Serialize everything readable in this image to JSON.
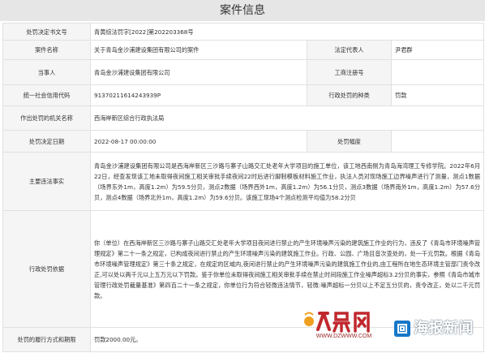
{
  "page": {
    "title": "案件信息"
  },
  "rows": {
    "decision_no": {
      "label": "处罚决定书文号",
      "value": "青黄综法罚字[2022]第202203368号"
    },
    "case_name": {
      "label": "案件名称",
      "value": "关于青岛金沙浦建设集团有限公司的案件"
    },
    "legal_rep": {
      "label": "法定代表人",
      "value": "尹君群"
    },
    "party": {
      "label": "当事人",
      "value": "青岛金沙浦建设集团有限公司"
    },
    "reg_no": {
      "label": "工商注册号",
      "value": ""
    },
    "credit_code": {
      "label": "统一社会信用代码",
      "value": "91370211614243939P"
    },
    "penalty_type": {
      "label": "行政处罚的种类",
      "value": "罚款"
    },
    "authority": {
      "label": "作出处罚的机关名称",
      "value": "西海岸新区综合行政执法局"
    },
    "decision_date": {
      "label": "处罚决定日期",
      "value": "2022-08-17 00:00:00"
    },
    "penalty_range": {
      "label": "处罚幅度",
      "value": ""
    },
    "violation": {
      "label": "主要违法事实",
      "value": "青岛金沙浦建设集团有限公司是西海岸新区三沙路与寨子山路交汇处老年大学项目的施工单位，该工地西南侧为青岛海湾理工专修学院。2022年6月22日，经查发现该工地未取得夜间施工相关审批手续夜间22时后进行脚制模板材料施工作业，执法人员对现场施工边界噪声进行了测量，测点1数据（场界东外1m，高度1.2m）为59.5分贝，测点2数据（场界西外1m，高度1.2m）为56.1分贝，测点3数据（场界南外1m，高度1.2m）为57.6分贝，测点4数据（场界北外1m，高度1.2m）为59.6分贝。该施工现场4个测点检测平均值为58.2分贝"
    },
    "basis": {
      "label": "行政处罚依据",
      "value": "你（单位）在西海岸新区三沙路与寨子山路交汇处老年大学项目夜间进行禁止的产生环境噪声污染的建筑施工作业的行为，违反了《青岛市环境噪声管理规定》第二十一条之规定，已构成夜间进行禁止的产生环境噪声污染的建筑施工作业。行政、公园、广场且音次查处的，处一千元罚款。根据《青岛市环境噪声管理规定》第三十条之规定，在规定的区域内,夜间进行禁止的产生环境噪声污染的建筑施工作业的,由工程所在地生态环境主管部门责令改正,可以处以两千元以上五万元以下罚款。鉴于你单位未取得夜间施工相关审批手续在禁止时间段施工作业噪声超标3.2分贝的事实，参照《青岛市城市管理行政处罚裁量基准》第四百二十一条之规定，你单位行为符合轻微违法情节，轻微:噪声超标一分贝以上不足五分贝的，责令改正，处以二千元罚款。"
    },
    "method": {
      "label": "处罚的履行方式和期限",
      "value": "罚款2000.00元。"
    }
  },
  "watermarks": {
    "daily_logo_text": "大众网",
    "daily_url": "WWW.DZWWW.COM",
    "news_text": "海报新闻",
    "news_color": "#1677c8",
    "daily_color": "#c0282d"
  }
}
